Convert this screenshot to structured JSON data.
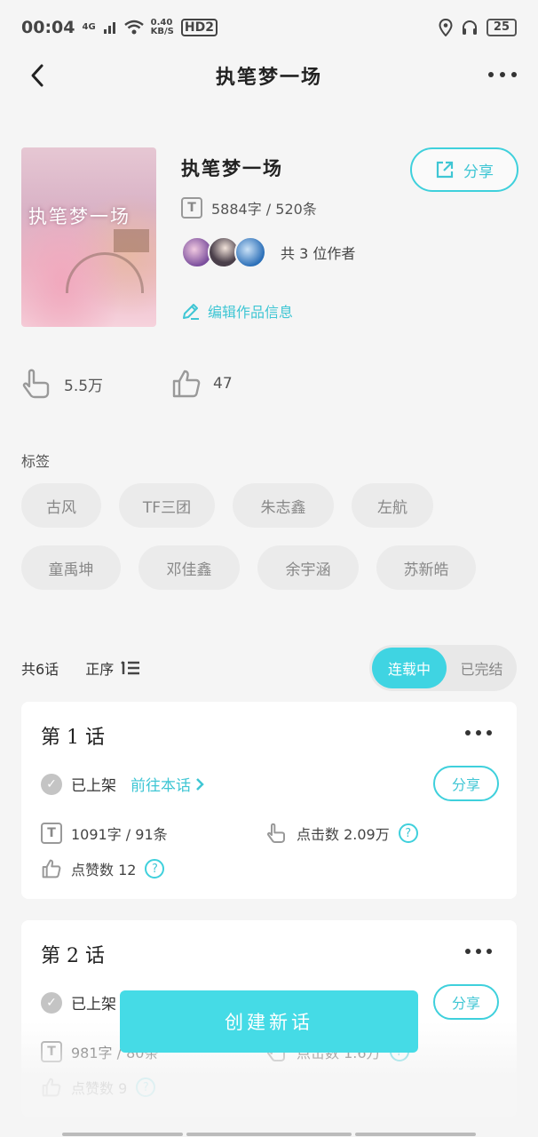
{
  "status_bar": {
    "time": "00:04",
    "network": "4G",
    "speed": "0.40",
    "speed_unit": "KB/S",
    "hd": "HD2",
    "battery": "25"
  },
  "nav": {
    "title": "执笔梦一场"
  },
  "work": {
    "cover_title": "执笔梦一场",
    "title": "执笔梦一场",
    "share_label": "分享",
    "word_stats": "5884字 / 520条",
    "authors_count": "共 3 位作者",
    "edit_label": "编辑作品信息",
    "views": "5.5万",
    "likes": "47"
  },
  "tags": {
    "label": "标签",
    "items": [
      "古风",
      "TF三团",
      "朱志鑫",
      "左航",
      "童禹坤",
      "邓佳鑫",
      "余宇涵",
      "苏新皓"
    ]
  },
  "list": {
    "count": "共6话",
    "sort_label": "正序",
    "seg_active": "连载中",
    "seg_inactive": "已完结"
  },
  "chapters": [
    {
      "title": "第 1 话",
      "status": "已上架",
      "goto": "前往本话",
      "share": "分享",
      "words": "1091字 / 91条",
      "clicks": "点击数 2.09万",
      "likes": "点赞数 12"
    },
    {
      "title": "第 2 话",
      "status": "已上架",
      "share": "分享",
      "words": "981字 / 80条",
      "clicks": "点击数 1.6万",
      "likes": "点赞数 9"
    }
  ],
  "create_button": "创建新话",
  "colors": {
    "accent": "#3fd0dc",
    "button": "#45dbe6",
    "background": "#f5f5f5"
  }
}
